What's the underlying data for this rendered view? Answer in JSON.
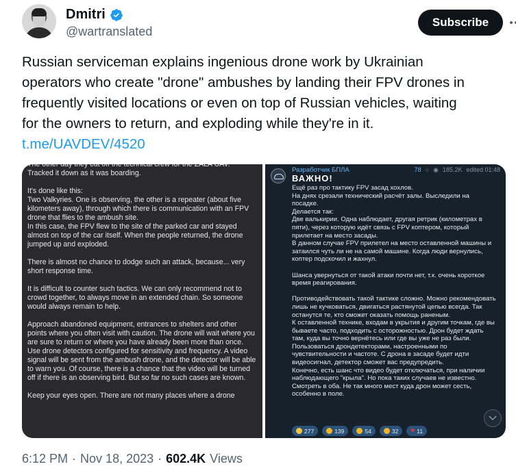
{
  "author": {
    "name": "Dmitri",
    "handle": "@wartranslated",
    "verified": true
  },
  "actions": {
    "subscribe_label": "Subscribe",
    "more_icon": "more-horizontal-icon"
  },
  "tweet": {
    "text_lines": [
      "Russian serviceman explains ingenious drone work by Ukrainian",
      "operators who create \"drone\" ambushes by landing their FPV drones in",
      "frequently visited locations or even on top of Russian vehicles, waiting",
      "for the owners to return, and exploding while they're in it."
    ],
    "link": "t.me/UAVDEV/4520"
  },
  "media_left": {
    "paragraphs": [
      "The other day they cut off the technical crew for the ZALA UAV. Tracked it down as it was boarding.",
      "It's done like this:\nTwo Valkyries. One is observing, the other is a repeater (about five kilometers away), through which there is communication with an FPV drone that flies to the ambush site.\nIn this case, the FPV flew to the site of the parked car and stayed almost on top of the car itself. When the people returned, the drone jumped up and exploded.",
      "There is almost no chance to dodge such an attack, because... very short response time.",
      "It is difficult to counter such tactics. We can only recommend not to crowd together, to always move in an extended chain. So someone would always remain to help.",
      "Approach abandoned equipment, entrances to shelters and other points where you often visit with caution. The drone will wait where you are sure to return or where you have already been more than once.\nUse drone detectors configured for sensitivity and frequency. A video signal will be sent from the ambush drone, and the detector will be able to warn you. Of course, there is a chance that the video will be turned off if there is an observing bird. But so far no such cases are known.",
      "Keep your eyes open. There are not many places where a drone"
    ]
  },
  "media_right": {
    "channel": "Разработчик БПЛА",
    "comments": "78",
    "views": "185.2K",
    "edited": "edited 01:48",
    "title": "ВАЖНО!",
    "paragraphs": [
      "Ещё раз про тактику FPV засад хохлов.\nНа днях срезали технический расчёт залы. Выследили на посадке.\nДелается так:\nДве валькирии. Одна наблюдает, другая ретрик (километрах в пяти), через которую идёт связь с FPV коптером, который прилетает на место засады.\nВ данном случае FPV прилетел на место оставленной машины и затаился чуть ли не на самой машине. Когда люди вернулись, коптер подскочил и жахнул.",
      "Шанса увернуться от такой атаки почти нет, т.к. очень короткое время реагирования.",
      "Противодействовать такой тактике сложно. Можно рекомендовать лишь не кучковаться, двигаться растянутой цепью всегда. Так останутся те, кто сможет оказать помощь раненым.\nК оставленной технике, входам в укрытия и другим точкам, где вы бываете часто, подходить с осторожностью. Дрон будет ждать там, куда вы точно вернётесь или где вы уже не раз были.\nПользоваться дрондетекторами, настроенными по чувствительности и частоте. С дрона в засаде будет идти видеосигнал, детектор сможет вас предупредить.\nКонечно, есть шанс что видео будет отключаться, при наличии наблюдающего \"крыла\". Но пока таких случаев не известно.\nСмотреть в оба. Не так много мест куда дрон может сесть, особенно в поле."
    ],
    "reactions": [
      {
        "emoji": "thumbs-up",
        "count": "277",
        "color": "#f5c542"
      },
      {
        "emoji": "thinking",
        "count": "139",
        "color": "#f0b429"
      },
      {
        "emoji": "thinking",
        "count": "54",
        "color": "#f0b429"
      },
      {
        "emoji": "grimace",
        "count": "32",
        "color": "#f0b429"
      },
      {
        "emoji": "heart",
        "count": "11",
        "color": "#e53946"
      }
    ]
  },
  "footer": {
    "time": "6:12 PM",
    "separator": "·",
    "date": "Nov 18, 2023",
    "views_count": "602.4K",
    "views_label": "Views"
  }
}
